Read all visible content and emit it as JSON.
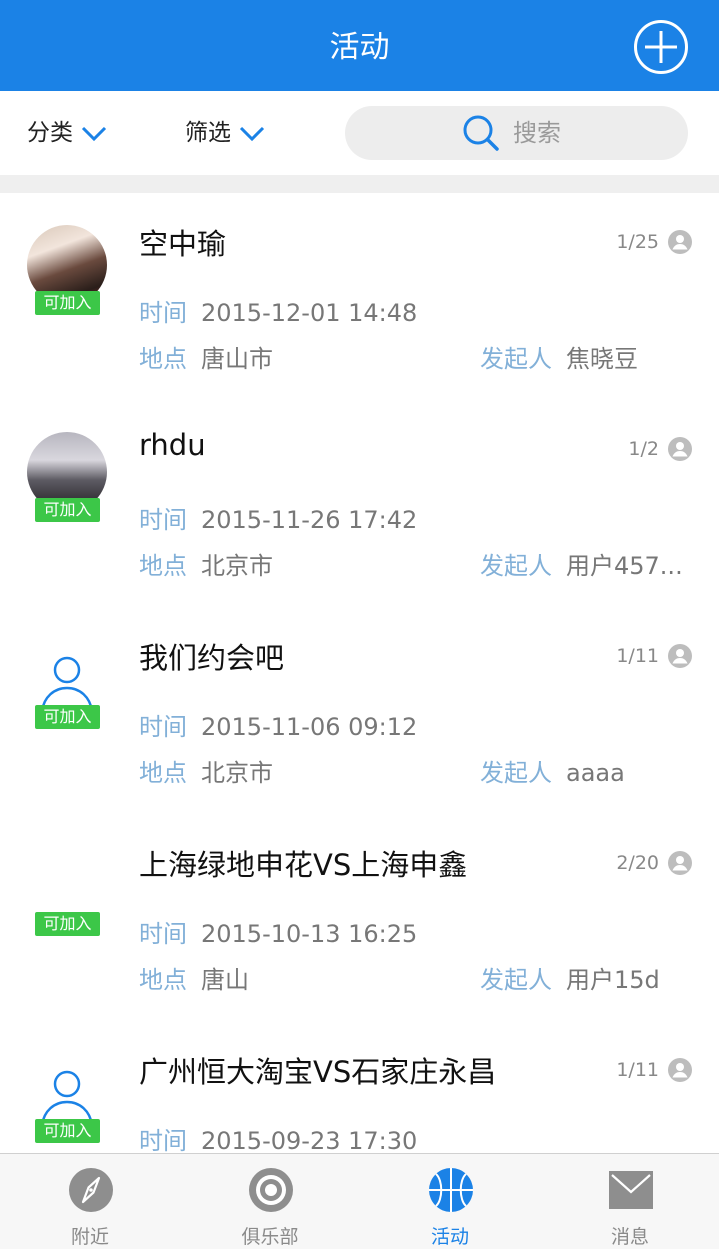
{
  "header": {
    "title": "活动"
  },
  "toolbar": {
    "category_label": "分类",
    "filter_label": "筛选",
    "search_placeholder": "搜索"
  },
  "colors": {
    "primary": "#1B82E6",
    "badge": "#3CC748",
    "label": "#82B0D8"
  },
  "labels": {
    "time": "时间",
    "place": "地点",
    "organizer": "发起人"
  },
  "activities": [
    {
      "title": "空中瑜",
      "count": "1/25",
      "badge": "可加入",
      "time": "2015-12-01 14:48",
      "place": "唐山市",
      "organizer": "焦晓豆",
      "avatar": "photo-avatar"
    },
    {
      "title": "rhdu",
      "count": "1/2",
      "badge": "可加入",
      "time": "2015-11-26 17:42",
      "place": "北京市",
      "organizer": "用户457...",
      "avatar": "photo-avatar"
    },
    {
      "title": "我们约会吧",
      "count": "1/11",
      "badge": "可加入",
      "time": "2015-11-06 09:12",
      "place": "北京市",
      "organizer": "aaaa",
      "avatar": "default-user-icon"
    },
    {
      "title": "上海绿地申花VS上海申鑫",
      "count": "2/20",
      "badge": "可加入",
      "time": "2015-10-13 16:25",
      "place": "唐山",
      "organizer": "用户15d",
      "avatar": "none"
    },
    {
      "title": "广州恒大淘宝VS石家庄永昌",
      "count": "1/11",
      "badge": "可加入",
      "time": "2015-09-23 17:30",
      "place": "",
      "organizer": "",
      "avatar": "default-user-icon"
    }
  ],
  "tabs": [
    {
      "label": "附近",
      "icon": "compass-icon"
    },
    {
      "label": "俱乐部",
      "icon": "target-icon"
    },
    {
      "label": "活动",
      "icon": "basketball-icon"
    },
    {
      "label": "消息",
      "icon": "envelope-icon"
    }
  ]
}
